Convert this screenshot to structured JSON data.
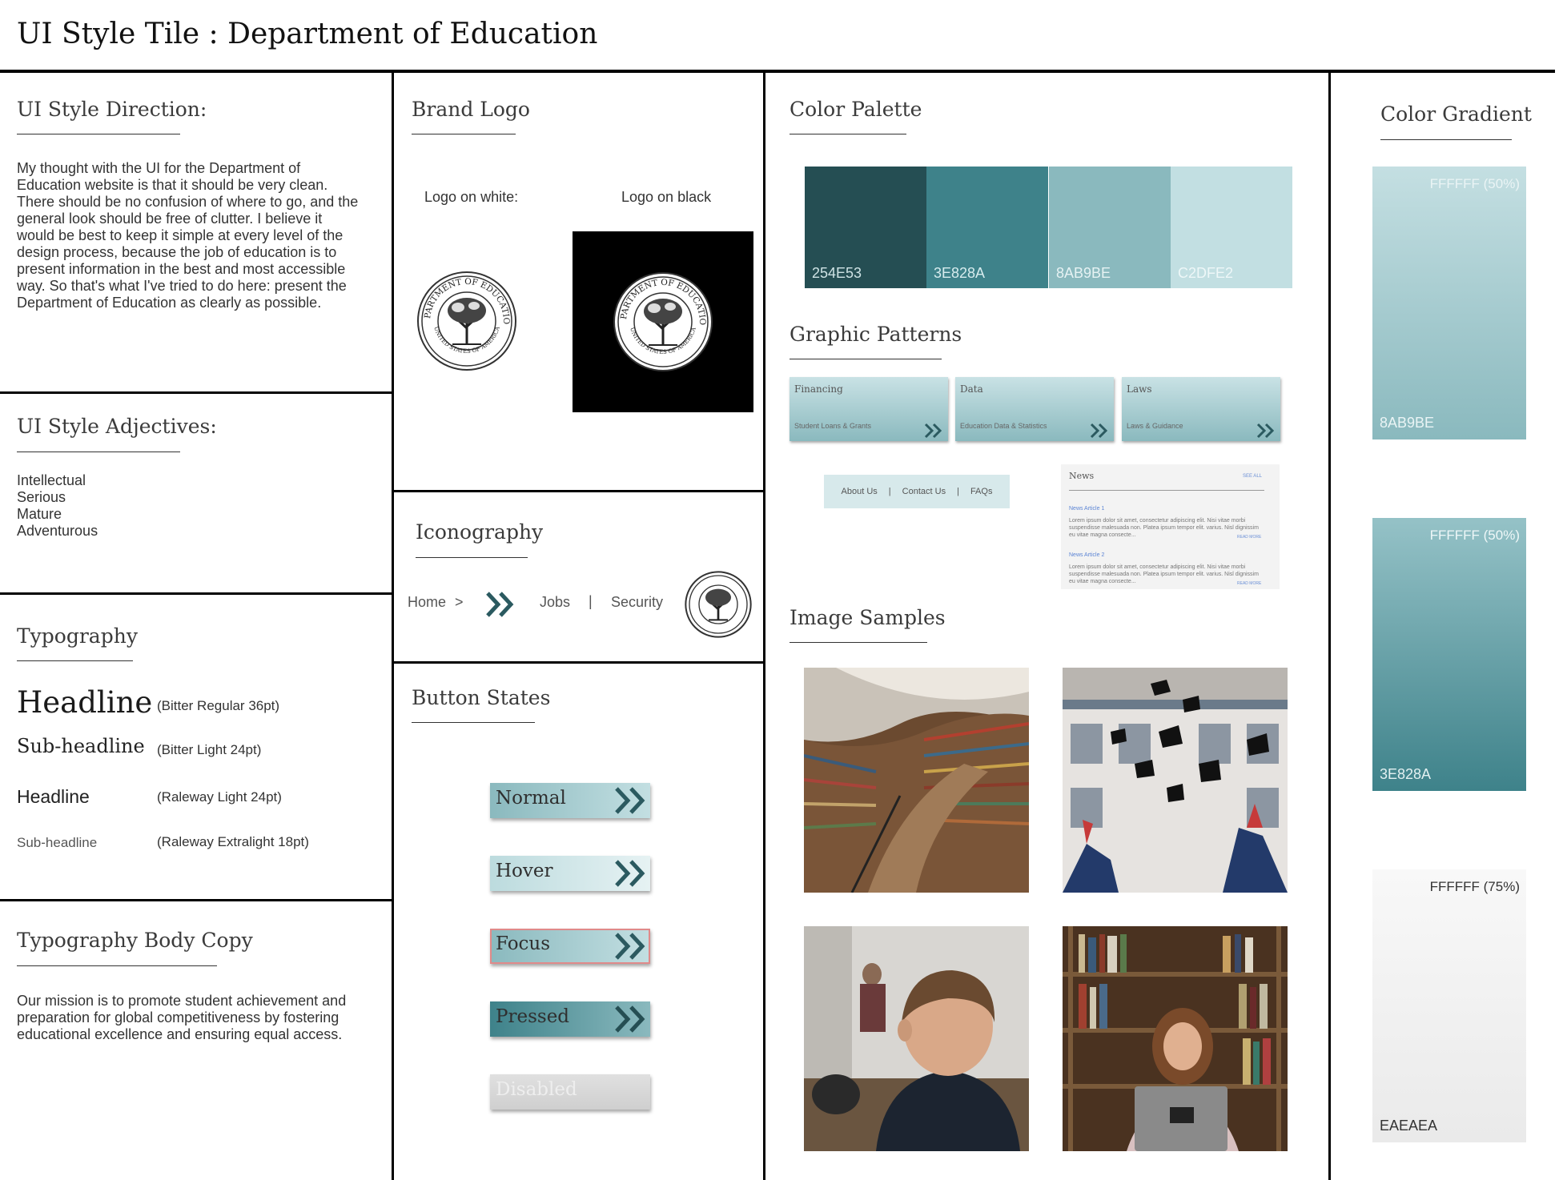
{
  "page_title": "UI Style Tile : Department of Education",
  "direction": {
    "title": "UI Style Direction:",
    "body": "My thought with the UI for the Department of Education website is that it should be very clean. There should be no confusion of where to go, and the general look should be free of clutter. I believe it would be best to keep it simple at every level of the design process, because the job of education is to present information in the best and most accessible way. So that's what I've tried to do here: present the Department of Education as clearly as possible."
  },
  "adjectives": {
    "title": "UI Style Adjectives:",
    "items": [
      "Intellectual",
      "Serious",
      "Mature",
      "Adventurous"
    ]
  },
  "typography": {
    "title": "Typography",
    "rows": [
      {
        "sample": "Headline",
        "spec": "(Bitter Regular 36pt)"
      },
      {
        "sample": "Sub-headline",
        "spec": "(Bitter Light 24pt)"
      },
      {
        "sample": "Headline",
        "spec": "(Raleway Light 24pt)"
      },
      {
        "sample": "Sub-headline",
        "spec": "(Raleway Extralight 18pt)"
      }
    ]
  },
  "body_copy": {
    "title": "Typography Body Copy",
    "body": "Our mission is to promote student achievement and preparation for global competitiveness by fostering educational excellence and ensuring equal access."
  },
  "brand_logo": {
    "title": "Brand Logo",
    "on_white_label": "Logo on white:",
    "on_black_label": "Logo on black",
    "seal_top_text": "DEPARTMENT OF EDUCATION",
    "seal_bottom_text": "UNITED STATES OF AMERICA"
  },
  "iconography": {
    "title": "Iconography",
    "home": "Home",
    "home_arrow": ">",
    "jobs": "Jobs",
    "separator": "|",
    "security": "Security",
    "icons": [
      "chevron-double-right-icon",
      "seal-icon"
    ]
  },
  "buttons": {
    "title": "Button States",
    "states": [
      {
        "label": "Normal",
        "state": "normal"
      },
      {
        "label": "Hover",
        "state": "hover"
      },
      {
        "label": "Focus",
        "state": "focus"
      },
      {
        "label": "Pressed",
        "state": "pressed"
      },
      {
        "label": "Disabled",
        "state": "disabled"
      }
    ]
  },
  "palette": {
    "title": "Color Palette",
    "swatches": [
      {
        "hex": "254E53",
        "color": "#254E53",
        "text_color": "#cfe3e5"
      },
      {
        "hex": "3E828A",
        "color": "#3E828A",
        "text_color": "#d7ecee"
      },
      {
        "hex": "8AB9BE",
        "color": "#8AB9BE",
        "text_color": "#e6f2f3"
      },
      {
        "hex": "C2DFE2",
        "color": "#C2DFE2",
        "text_color": "#eef7f8"
      }
    ]
  },
  "patterns": {
    "title": "Graphic Patterns",
    "cards": [
      {
        "title": "Financing",
        "sub": "Student Loans & Grants"
      },
      {
        "title": "Data",
        "sub": "Education Data & Statistics"
      },
      {
        "title": "Laws",
        "sub": "Laws & Guidance"
      }
    ],
    "nav": [
      "About Us",
      "Contact Us",
      "FAQs"
    ],
    "nav_sep": "|",
    "news": {
      "title": "News",
      "see_all": "SEE ALL",
      "articles": [
        {
          "title": "News Article 1",
          "body": "Lorem ipsum dolor sit amet, consectetur adipiscing elit. Nisi vitae morbi suspendisse malesuada non. Platea ipsum tempor elit. varius. Nisl dignissim eu vitae magna consecte...",
          "more": "READ MORE"
        },
        {
          "title": "News Article 2",
          "body": "Lorem ipsum dolor sit amet, consectetur adipiscing elit. Nisi vitae morbi suspendisse malesuada non. Platea ipsum tempor elit. varius. Nisl dignissim eu vitae magna consecte...",
          "more": "READ MORE"
        }
      ]
    }
  },
  "images": {
    "title": "Image Samples",
    "items": [
      "library-photo",
      "graduation-photo",
      "classroom-photo",
      "student-laptop-photo"
    ]
  },
  "gradient": {
    "title": "Color Gradient",
    "tiles": [
      {
        "top_label": "FFFFFF (50%)",
        "bottom_label": "8AB9BE",
        "from": "#c4dfe2",
        "to": "#8AB9BE"
      },
      {
        "top_label": "FFFFFF (50%)",
        "bottom_label": "3E828A",
        "from": "#95c2c7",
        "to": "#3E828A"
      },
      {
        "top_label": "FFFFFF (75%)",
        "bottom_label": "EAEAEA",
        "from": "#f8f8f8",
        "to": "#EAEAEA"
      }
    ]
  }
}
